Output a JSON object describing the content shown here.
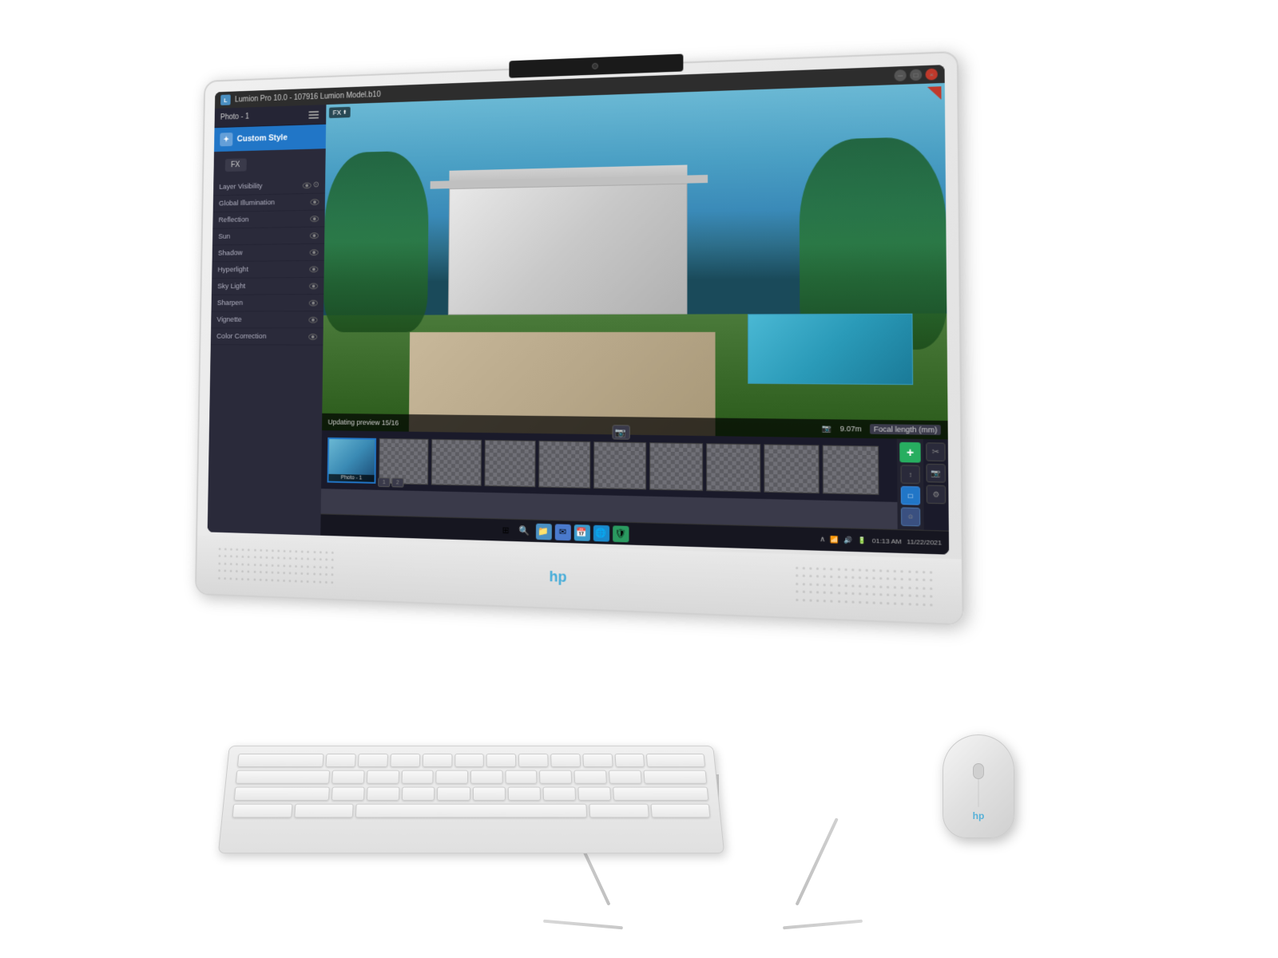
{
  "app": {
    "title": "Lumion Pro 10.0 - 107916 Lumion Model.b10",
    "photo_label": "Photo - 1",
    "menu_icon": "≡"
  },
  "sidebar": {
    "custom_style_label": "Custom Style",
    "fx_label": "FX",
    "items": [
      {
        "label": "Layer Visibility",
        "has_eye": true,
        "has_settings": true
      },
      {
        "label": "Global Illumination",
        "has_eye": true,
        "has_settings": false
      },
      {
        "label": "Reflection",
        "has_eye": true,
        "has_settings": false
      },
      {
        "label": "Sun",
        "has_eye": true,
        "has_settings": false
      },
      {
        "label": "Shadow",
        "has_eye": true,
        "has_settings": false
      },
      {
        "label": "Hyperlight",
        "has_eye": true,
        "has_settings": false
      },
      {
        "label": "Sky Light",
        "has_eye": true,
        "has_settings": false
      },
      {
        "label": "Sharpen",
        "has_eye": true,
        "has_settings": false
      },
      {
        "label": "Vignette",
        "has_eye": true,
        "has_settings": false
      },
      {
        "label": "Color Correction",
        "has_eye": true,
        "has_settings": false
      }
    ]
  },
  "render": {
    "fx_label": "FX",
    "status_text": "Updating preview 15/16",
    "focal_label": "Focal length (mm)",
    "zoom_value": "9.07m"
  },
  "filmstrip": {
    "active_label": "Photo - 1",
    "page_buttons": [
      "1",
      "2"
    ]
  },
  "taskbar": {
    "time": "01:13 AM",
    "date": "11/22/2021",
    "icons": [
      "⊞",
      "🔍",
      "📁",
      "✉",
      "📅",
      "🌐",
      "🛡"
    ]
  },
  "colors": {
    "accent_blue": "#2176c7",
    "background_dark": "#1e1e2e",
    "sidebar_bg": "#2a2a3a",
    "hp_blue": "#0096d6",
    "green_add": "#27ae60"
  }
}
